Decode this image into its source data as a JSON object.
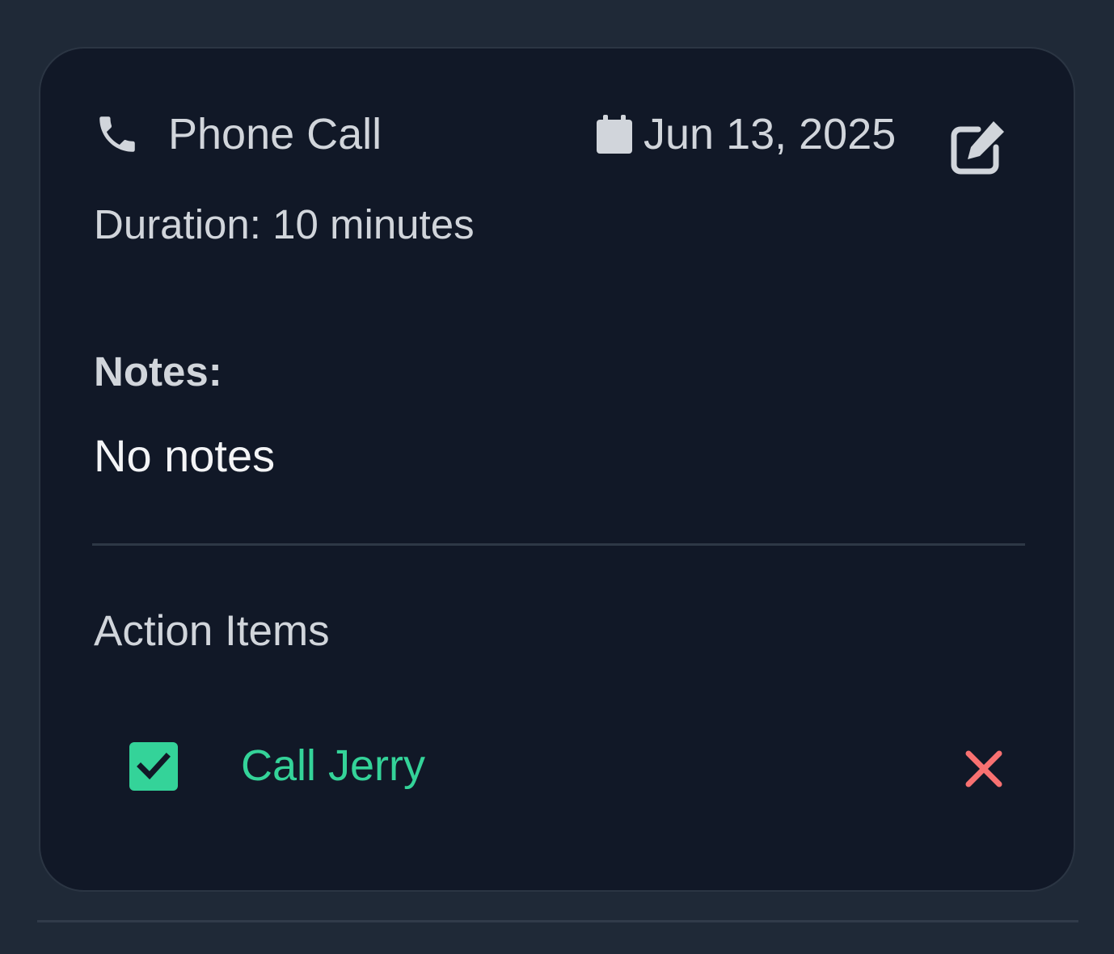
{
  "interaction": {
    "type_label": "Phone Call",
    "type_icon": "phone-icon",
    "date": "Jun 13, 2025",
    "date_icon": "calendar-icon",
    "edit_icon": "edit-icon",
    "duration": "Duration: 10 minutes",
    "notes_heading": "Notes:",
    "notes_text": "No notes"
  },
  "action_items": {
    "heading": "Action Items",
    "items": [
      {
        "text": "Call Jerry",
        "completed": true,
        "delete_icon": "close-icon"
      }
    ]
  },
  "colors": {
    "page_background": "#1f2937",
    "card_background": "#111827",
    "text_primary": "#d1d5db",
    "completed_green": "#34d399",
    "delete_red": "#f87171"
  }
}
